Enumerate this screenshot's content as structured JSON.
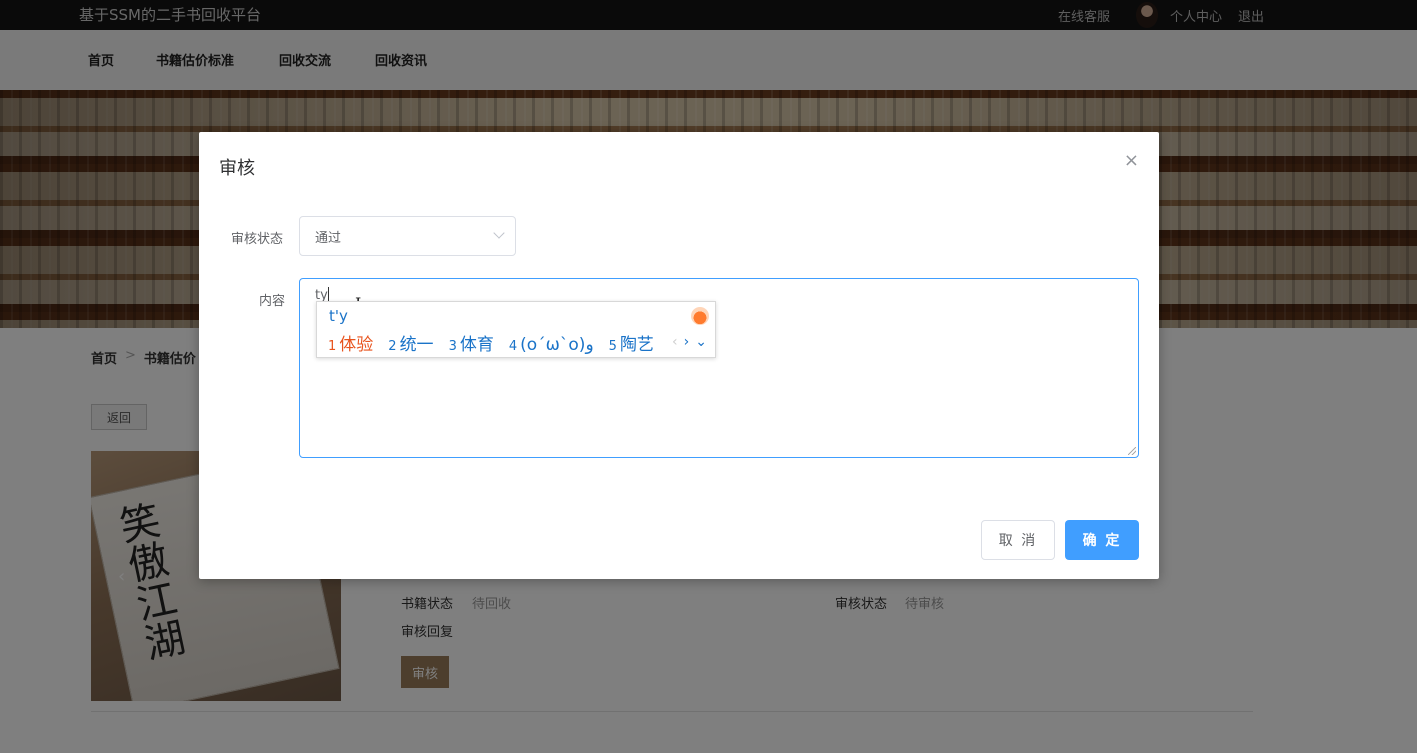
{
  "site": {
    "title": "基于SSM的二手书回收平台",
    "service": "在线客服",
    "profile": "个人中心",
    "logout": "退出"
  },
  "nav": {
    "items": [
      {
        "label": "首页"
      },
      {
        "label": "书籍估价标准"
      },
      {
        "label": "回收交流"
      },
      {
        "label": "回收资讯"
      }
    ]
  },
  "breadcrumb": {
    "home": "首页",
    "sep": ">",
    "current": "书籍估价"
  },
  "page": {
    "back_label": "返回",
    "book_cover_text": "笑傲江湖",
    "book_status_label": "书籍状态",
    "book_status_value": "待回收",
    "audit_status_label": "审核状态",
    "audit_status_value": "待审核",
    "audit_reply_label": "审核回复",
    "audit_button": "审核"
  },
  "dialog": {
    "title": "审核",
    "close_icon": "×",
    "status_label": "审核状态",
    "status_value": "通过",
    "content_label": "内容",
    "content_value": "ty",
    "cancel_label": "取 消",
    "confirm_label": "确 定",
    "accent_color": "#409eff"
  },
  "ime": {
    "pinyin": "t'y",
    "candidates": [
      {
        "num": "1",
        "text": "体验"
      },
      {
        "num": "2",
        "text": "统一"
      },
      {
        "num": "3",
        "text": "体育"
      },
      {
        "num": "4",
        "text": "(o´ω`o)و"
      },
      {
        "num": "5",
        "text": "陶艺"
      }
    ],
    "prev_icon": "‹",
    "next_icon": "›",
    "expand_icon": "⌄"
  }
}
